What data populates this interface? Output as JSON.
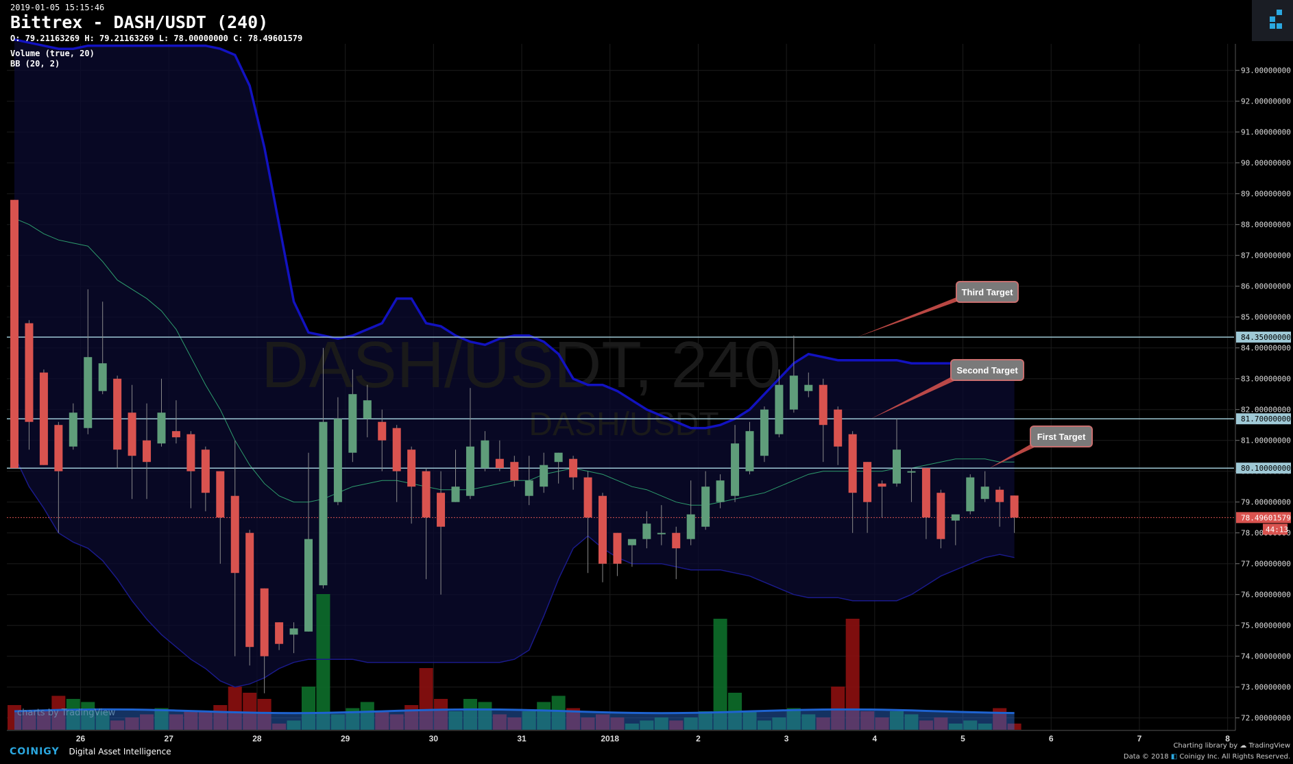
{
  "header": {
    "timestamp": "2019-01-05 15:15:46",
    "title": "Bittrex - DASH/USDT (240)",
    "ohlc": "O: 79.21163269 H: 79.21163269 L: 78.00000000 C: 78.49601579",
    "indicator_volume": "Volume (true, 20)",
    "indicator_bb": "BB (20, 2)"
  },
  "watermark": {
    "big": "DASH/USDT, 240",
    "small": "DASH/USDT",
    "tradingview": "charts by TradingView"
  },
  "footer": {
    "brand": "COINIGY",
    "tagline": "Digital Asset Intelligence",
    "charting": "Charting library by",
    "tv": "TradingView",
    "copyright": "Data © 2018",
    "copyright2": "Coinigy Inc. All Rights Reserved."
  },
  "colors": {
    "up": "#5f9d7a",
    "down": "#d9534f",
    "bb_mid": "#2e9e6e",
    "bb_band": "#1a1aa8",
    "hline": "#9fc9d6",
    "background": "#000000"
  },
  "chart_data": {
    "type": "candlestick",
    "title": "Bittrex - DASH/USDT (240)",
    "ylim": [
      71.5,
      93.5
    ],
    "y_ticks": [
      72,
      73,
      74,
      75,
      76,
      77,
      78,
      79,
      80,
      81,
      82,
      83,
      84,
      85,
      86,
      87,
      88,
      89,
      90,
      91,
      92,
      93
    ],
    "y_tick_labels": [
      "72.00000000",
      "73.00000000",
      "74.00000000",
      "75.00000000",
      "76.00000000",
      "77.00000000",
      "78.00000000",
      "79.00000000",
      "80.00000000",
      "81.00000000",
      "82.00000000",
      "83.00000000",
      "84.00000000",
      "85.00000000",
      "86.00000000",
      "87.00000000",
      "88.00000000",
      "89.00000000",
      "90.00000000",
      "91.00000000",
      "92.00000000",
      "93.00000000"
    ],
    "x_ticks": [
      {
        "label": "26",
        "i": 4.5
      },
      {
        "label": "27",
        "i": 10.5
      },
      {
        "label": "28",
        "i": 16.5
      },
      {
        "label": "29",
        "i": 22.5
      },
      {
        "label": "30",
        "i": 28.5
      },
      {
        "label": "31",
        "i": 34.5
      },
      {
        "label": "2018",
        "i": 40.5
      },
      {
        "label": "2",
        "i": 46.5
      },
      {
        "label": "3",
        "i": 52.5
      },
      {
        "label": "4",
        "i": 58.5
      },
      {
        "label": "5",
        "i": 64.5
      },
      {
        "label": "6",
        "i": 70.5
      },
      {
        "label": "7",
        "i": 76.5
      },
      {
        "label": "8",
        "i": 82.5
      }
    ],
    "candles": [
      {
        "o": 88.8,
        "h": 88.8,
        "l": 80.3,
        "c": 80.1
      },
      {
        "o": 84.8,
        "h": 84.9,
        "l": 80.7,
        "c": 81.6
      },
      {
        "o": 83.2,
        "h": 83.3,
        "l": 80.2,
        "c": 80.2
      },
      {
        "o": 81.5,
        "h": 81.6,
        "l": 78.0,
        "c": 80.0
      },
      {
        "o": 80.8,
        "h": 82.2,
        "l": 80.7,
        "c": 81.9
      },
      {
        "o": 81.4,
        "h": 85.9,
        "l": 81.2,
        "c": 83.7
      },
      {
        "o": 82.6,
        "h": 85.5,
        "l": 82.5,
        "c": 83.5
      },
      {
        "o": 83.0,
        "h": 83.1,
        "l": 80.1,
        "c": 80.7
      },
      {
        "o": 81.9,
        "h": 82.8,
        "l": 79.1,
        "c": 80.5
      },
      {
        "o": 81.0,
        "h": 82.2,
        "l": 79.1,
        "c": 80.3
      },
      {
        "o": 80.9,
        "h": 83.0,
        "l": 80.8,
        "c": 81.9
      },
      {
        "o": 81.3,
        "h": 82.3,
        "l": 80.9,
        "c": 81.1
      },
      {
        "o": 81.2,
        "h": 81.3,
        "l": 78.8,
        "c": 80.0
      },
      {
        "o": 80.7,
        "h": 80.8,
        "l": 78.7,
        "c": 79.3
      },
      {
        "o": 80.0,
        "h": 80.0,
        "l": 77.0,
        "c": 78.5
      },
      {
        "o": 79.2,
        "h": 81.0,
        "l": 74.0,
        "c": 76.7
      },
      {
        "o": 78.0,
        "h": 78.1,
        "l": 73.7,
        "c": 74.3
      },
      {
        "o": 76.2,
        "h": 76.2,
        "l": 72.8,
        "c": 74.0
      },
      {
        "o": 75.1,
        "h": 75.1,
        "l": 74.2,
        "c": 74.4
      },
      {
        "o": 74.7,
        "h": 75.1,
        "l": 74.1,
        "c": 74.9
      },
      {
        "o": 74.8,
        "h": 80.6,
        "l": 74.8,
        "c": 77.8
      },
      {
        "o": 76.3,
        "h": 84.0,
        "l": 76.2,
        "c": 81.6
      },
      {
        "o": 79.0,
        "h": 82.4,
        "l": 78.9,
        "c": 81.7
      },
      {
        "o": 80.6,
        "h": 83.3,
        "l": 80.3,
        "c": 82.5
      },
      {
        "o": 81.7,
        "h": 82.8,
        "l": 81.1,
        "c": 82.3
      },
      {
        "o": 81.6,
        "h": 82.0,
        "l": 80.0,
        "c": 81.0
      },
      {
        "o": 81.4,
        "h": 81.5,
        "l": 79.0,
        "c": 80.0
      },
      {
        "o": 80.7,
        "h": 80.8,
        "l": 78.3,
        "c": 79.5
      },
      {
        "o": 80.0,
        "h": 80.1,
        "l": 76.5,
        "c": 78.5
      },
      {
        "o": 79.3,
        "h": 80.0,
        "l": 76.0,
        "c": 78.2
      },
      {
        "o": 79.0,
        "h": 80.7,
        "l": 79.0,
        "c": 79.5
      },
      {
        "o": 79.2,
        "h": 82.7,
        "l": 79.1,
        "c": 80.8
      },
      {
        "o": 80.1,
        "h": 81.3,
        "l": 80.0,
        "c": 81.0
      },
      {
        "o": 80.4,
        "h": 81.0,
        "l": 80.0,
        "c": 80.1
      },
      {
        "o": 80.3,
        "h": 80.5,
        "l": 79.5,
        "c": 79.7
      },
      {
        "o": 79.2,
        "h": 80.5,
        "l": 78.9,
        "c": 79.7
      },
      {
        "o": 79.5,
        "h": 80.6,
        "l": 79.3,
        "c": 80.2
      },
      {
        "o": 80.3,
        "h": 80.6,
        "l": 79.6,
        "c": 80.6
      },
      {
        "o": 80.4,
        "h": 80.5,
        "l": 79.4,
        "c": 79.8
      },
      {
        "o": 79.8,
        "h": 80.0,
        "l": 76.7,
        "c": 78.5
      },
      {
        "o": 79.2,
        "h": 79.3,
        "l": 76.4,
        "c": 77.0
      },
      {
        "o": 78.0,
        "h": 78.0,
        "l": 76.6,
        "c": 77.0
      },
      {
        "o": 77.6,
        "h": 77.7,
        "l": 76.9,
        "c": 77.8
      },
      {
        "o": 77.8,
        "h": 78.7,
        "l": 77.5,
        "c": 78.3
      },
      {
        "o": 78.0,
        "h": 78.9,
        "l": 77.6,
        "c": 78.0
      },
      {
        "o": 78.0,
        "h": 78.2,
        "l": 76.5,
        "c": 77.5
      },
      {
        "o": 77.8,
        "h": 79.7,
        "l": 77.6,
        "c": 78.6
      },
      {
        "o": 78.2,
        "h": 80.0,
        "l": 78.1,
        "c": 79.5
      },
      {
        "o": 79.0,
        "h": 79.9,
        "l": 78.8,
        "c": 79.7
      },
      {
        "o": 79.2,
        "h": 81.5,
        "l": 79.0,
        "c": 80.9
      },
      {
        "o": 80.0,
        "h": 81.6,
        "l": 79.9,
        "c": 81.3
      },
      {
        "o": 80.5,
        "h": 82.1,
        "l": 80.3,
        "c": 82.0
      },
      {
        "o": 81.2,
        "h": 83.3,
        "l": 81.1,
        "c": 82.8
      },
      {
        "o": 82.0,
        "h": 84.4,
        "l": 81.9,
        "c": 83.1
      },
      {
        "o": 82.6,
        "h": 83.2,
        "l": 82.4,
        "c": 82.8
      },
      {
        "o": 82.8,
        "h": 83.0,
        "l": 80.3,
        "c": 81.5
      },
      {
        "o": 82.0,
        "h": 82.1,
        "l": 80.2,
        "c": 80.8
      },
      {
        "o": 81.2,
        "h": 81.3,
        "l": 78.0,
        "c": 79.3
      },
      {
        "o": 80.3,
        "h": 80.3,
        "l": 78.0,
        "c": 79.0
      },
      {
        "o": 79.6,
        "h": 79.7,
        "l": 78.5,
        "c": 79.5
      },
      {
        "o": 79.6,
        "h": 81.7,
        "l": 79.5,
        "c": 80.7
      },
      {
        "o": 80.0,
        "h": 80.1,
        "l": 79.0,
        "c": 80.0
      },
      {
        "o": 80.1,
        "h": 80.1,
        "l": 77.8,
        "c": 78.5
      },
      {
        "o": 79.3,
        "h": 79.4,
        "l": 77.5,
        "c": 77.8
      },
      {
        "o": 78.4,
        "h": 78.5,
        "l": 77.6,
        "c": 78.6
      },
      {
        "o": 78.7,
        "h": 79.9,
        "l": 78.6,
        "c": 79.8
      },
      {
        "o": 79.1,
        "h": 80.0,
        "l": 79.0,
        "c": 79.5
      },
      {
        "o": 79.4,
        "h": 79.5,
        "l": 78.2,
        "c": 79.0
      },
      {
        "o": 79.21163269,
        "h": 79.21163269,
        "l": 78.0,
        "c": 78.49601579
      }
    ],
    "volume": [
      0.4,
      0.3,
      0.3,
      0.55,
      0.5,
      0.45,
      0.3,
      0.15,
      0.2,
      0.25,
      0.35,
      0.25,
      0.3,
      0.3,
      0.4,
      0.7,
      0.6,
      0.5,
      0.1,
      0.15,
      0.7,
      2.2,
      0.25,
      0.35,
      0.45,
      0.3,
      0.25,
      0.4,
      1.0,
      0.5,
      0.3,
      0.5,
      0.45,
      0.25,
      0.2,
      0.3,
      0.45,
      0.55,
      0.35,
      0.2,
      0.25,
      0.2,
      0.1,
      0.15,
      0.2,
      0.15,
      0.2,
      0.3,
      1.8,
      0.6,
      0.3,
      0.15,
      0.2,
      0.35,
      0.25,
      0.2,
      0.7,
      1.8,
      0.3,
      0.2,
      0.3,
      0.25,
      0.15,
      0.2,
      0.1,
      0.15,
      0.1,
      0.35,
      0.1
    ],
    "bb_mid": [
      88.2,
      88.0,
      87.7,
      87.5,
      87.4,
      87.3,
      86.8,
      86.2,
      85.9,
      85.6,
      85.2,
      84.6,
      83.7,
      82.8,
      82.0,
      81.0,
      80.2,
      79.6,
      79.2,
      79.0,
      79.0,
      79.1,
      79.3,
      79.5,
      79.6,
      79.7,
      79.7,
      79.6,
      79.5,
      79.4,
      79.4,
      79.4,
      79.5,
      79.6,
      79.7,
      79.7,
      79.9,
      80.0,
      80.1,
      80.0,
      79.9,
      79.7,
      79.5,
      79.4,
      79.2,
      79.0,
      78.9,
      78.9,
      79.0,
      79.1,
      79.2,
      79.3,
      79.5,
      79.7,
      79.9,
      80.0,
      80.0,
      80.0,
      80.0,
      80.0,
      80.1,
      80.1,
      80.2,
      80.3,
      80.4,
      80.4,
      80.4,
      80.3,
      80.3
    ],
    "bb_upper": [
      94.0,
      93.9,
      93.8,
      93.7,
      93.7,
      93.8,
      93.8,
      93.8,
      93.8,
      93.8,
      93.8,
      93.8,
      93.8,
      93.8,
      93.7,
      93.5,
      92.5,
      90.5,
      88.0,
      85.5,
      84.5,
      84.4,
      84.3,
      84.4,
      84.6,
      84.8,
      85.6,
      85.6,
      84.8,
      84.7,
      84.4,
      84.2,
      84.1,
      84.3,
      84.4,
      84.4,
      84.2,
      83.8,
      83.0,
      82.8,
      82.8,
      82.6,
      82.3,
      82.0,
      81.8,
      81.6,
      81.4,
      81.4,
      81.5,
      81.7,
      82.0,
      82.5,
      83.0,
      83.5,
      83.8,
      83.7,
      83.6,
      83.6,
      83.6,
      83.6,
      83.6,
      83.5,
      83.5,
      83.5,
      83.5,
      83.5,
      83.5,
      83.5,
      83.5
    ],
    "bb_lower": [
      80.5,
      79.5,
      78.8,
      78.0,
      77.7,
      77.5,
      77.1,
      76.5,
      75.8,
      75.2,
      74.7,
      74.3,
      73.9,
      73.6,
      73.2,
      73.0,
      73.1,
      73.3,
      73.6,
      73.8,
      73.9,
      73.9,
      73.9,
      73.9,
      73.8,
      73.8,
      73.8,
      73.8,
      73.8,
      73.8,
      73.8,
      73.8,
      73.8,
      73.8,
      73.9,
      74.2,
      75.3,
      76.5,
      77.5,
      77.9,
      77.5,
      77.2,
      77.0,
      77.0,
      77.0,
      76.9,
      76.8,
      76.8,
      76.8,
      76.7,
      76.6,
      76.4,
      76.2,
      76.0,
      75.9,
      75.9,
      75.9,
      75.8,
      75.8,
      75.8,
      75.8,
      76.0,
      76.3,
      76.6,
      76.8,
      77.0,
      77.2,
      77.3,
      77.2
    ],
    "horizontal_lines": [
      {
        "value": 84.35,
        "label": "84.35000000"
      },
      {
        "value": 81.7,
        "label": "81.70000000"
      },
      {
        "value": 80.1,
        "label": "80.10000000"
      }
    ],
    "current_price": {
      "value": 78.49601579,
      "label": "78.49601579",
      "countdown": "44:13"
    },
    "annotations": [
      {
        "text": "Third Target",
        "line_value": 84.35
      },
      {
        "text": "Second Target",
        "line_value": 81.7
      },
      {
        "text": "First Target",
        "line_value": 80.1
      }
    ]
  }
}
